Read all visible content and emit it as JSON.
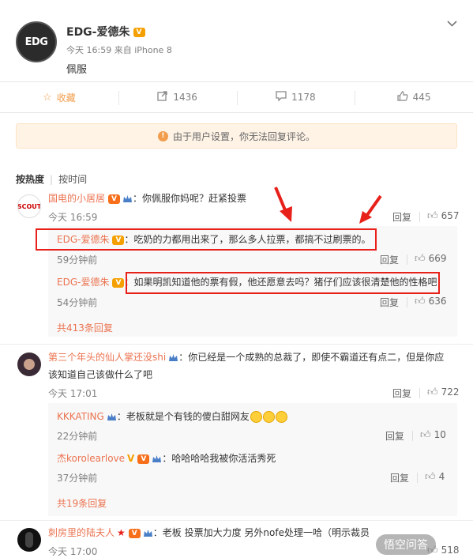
{
  "post": {
    "avatar_text": "EDG",
    "author": "EDG-爱德朱",
    "meta": "今天 16:59 来自 iPhone 8",
    "text": "佩服"
  },
  "actions": {
    "favorite": "收藏",
    "forward": "1436",
    "comment": "1178",
    "like": "445"
  },
  "notice": "由于用户设置，你无法回复评论。",
  "sort": {
    "hot": "按热度",
    "time": "按时间"
  },
  "reply_label": "回复",
  "comments": [
    {
      "avatar_text": "SCOUT",
      "user": "国电的小居居",
      "text": "：你佩服你妈呢？赶紧投票",
      "time": "今天 16:59",
      "likes": "657",
      "subs": [
        {
          "user": "EDG-爱德朱",
          "text": "：吃奶的力都用出来了，那么多人拉票，都搞不过刷票的。",
          "time": "59分钟前",
          "likes": "669"
        },
        {
          "user": "EDG-爱德朱",
          "text": "：如果明凯知道他的票有假，他还愿意去吗？猪仔们应该很清楚他的性格吧",
          "time": "54分钟前",
          "likes": "636"
        }
      ],
      "more": "共413条回复"
    },
    {
      "user": "第三个年头的仙人掌还没shi",
      "text_line1": "：你已经是一个成熟的总裁了，即使不霸道还有点二，但是你应",
      "text_line2": "该知道自己该做什么了吧",
      "time": "今天 17:01",
      "likes": "722",
      "subs": [
        {
          "user": "KKKATING",
          "text": "：老板就是个有钱的傻白甜网友",
          "time": "22分钟前",
          "likes": "10"
        },
        {
          "user": "杰korolearlove",
          "text": "：哈哈哈哈我被你活活秀死",
          "time": "37分钟前",
          "likes": "4"
        }
      ],
      "more": "共19条回复"
    },
    {
      "user": "刺房里的陆夫人",
      "text": "：老板 投票加大力度 另外nofe处理一哈（明示裁员",
      "time": "今天 17:00",
      "likes": "518"
    }
  ],
  "watermark": "悟空问答",
  "colors": {
    "username": "#eb7350",
    "highlight": "#e8201a",
    "notice_bg": "#fff3e6"
  }
}
